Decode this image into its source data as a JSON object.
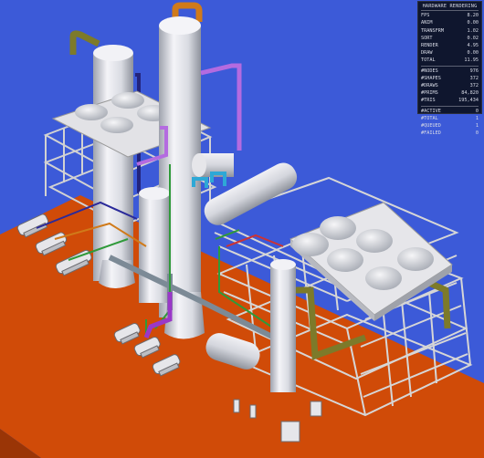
{
  "stats_panel": {
    "title": "HARDWARE RENDERING",
    "group1": [
      {
        "label": "FPS",
        "value": "8.20"
      },
      {
        "label": "ANIM",
        "value": "0.00"
      },
      {
        "label": "TRANSFRM",
        "value": "1.02"
      },
      {
        "label": "SORT",
        "value": "0.02"
      },
      {
        "label": "RENDER",
        "value": "4.95"
      },
      {
        "label": "DRAW",
        "value": "0.00"
      },
      {
        "label": "TOTAL",
        "value": "11.95"
      }
    ],
    "group2": [
      {
        "label": "#NODES",
        "value": "976"
      },
      {
        "label": "#SHAPES",
        "value": "372"
      },
      {
        "label": "#DRAWS",
        "value": "372"
      },
      {
        "label": "#PRIMS",
        "value": "84,820"
      },
      {
        "label": "#TRIS",
        "value": "195,434"
      }
    ],
    "group3": [
      {
        "label": "#ACTIVE",
        "value": "0"
      },
      {
        "label": "#TOTAL",
        "value": "1"
      },
      {
        "label": "#QUEUED",
        "value": "1"
      },
      {
        "label": "#FAILED",
        "value": "0"
      }
    ]
  },
  "colors": {
    "background": "#3c5ad8",
    "ground": "#d04b08",
    "ground_edge": "#9a3506",
    "steel": "#d6d6d6",
    "vessel": "#e8e8ee",
    "pipe_olive": "#7d7a2a",
    "pipe_purple": "#b46be0",
    "pipe_navy": "#23237a",
    "pipe_cyan": "#2ea8d6",
    "pipe_orange": "#d07a1a",
    "pipe_grey": "#7c8a96",
    "pipe_green": "#2f9a3a"
  }
}
